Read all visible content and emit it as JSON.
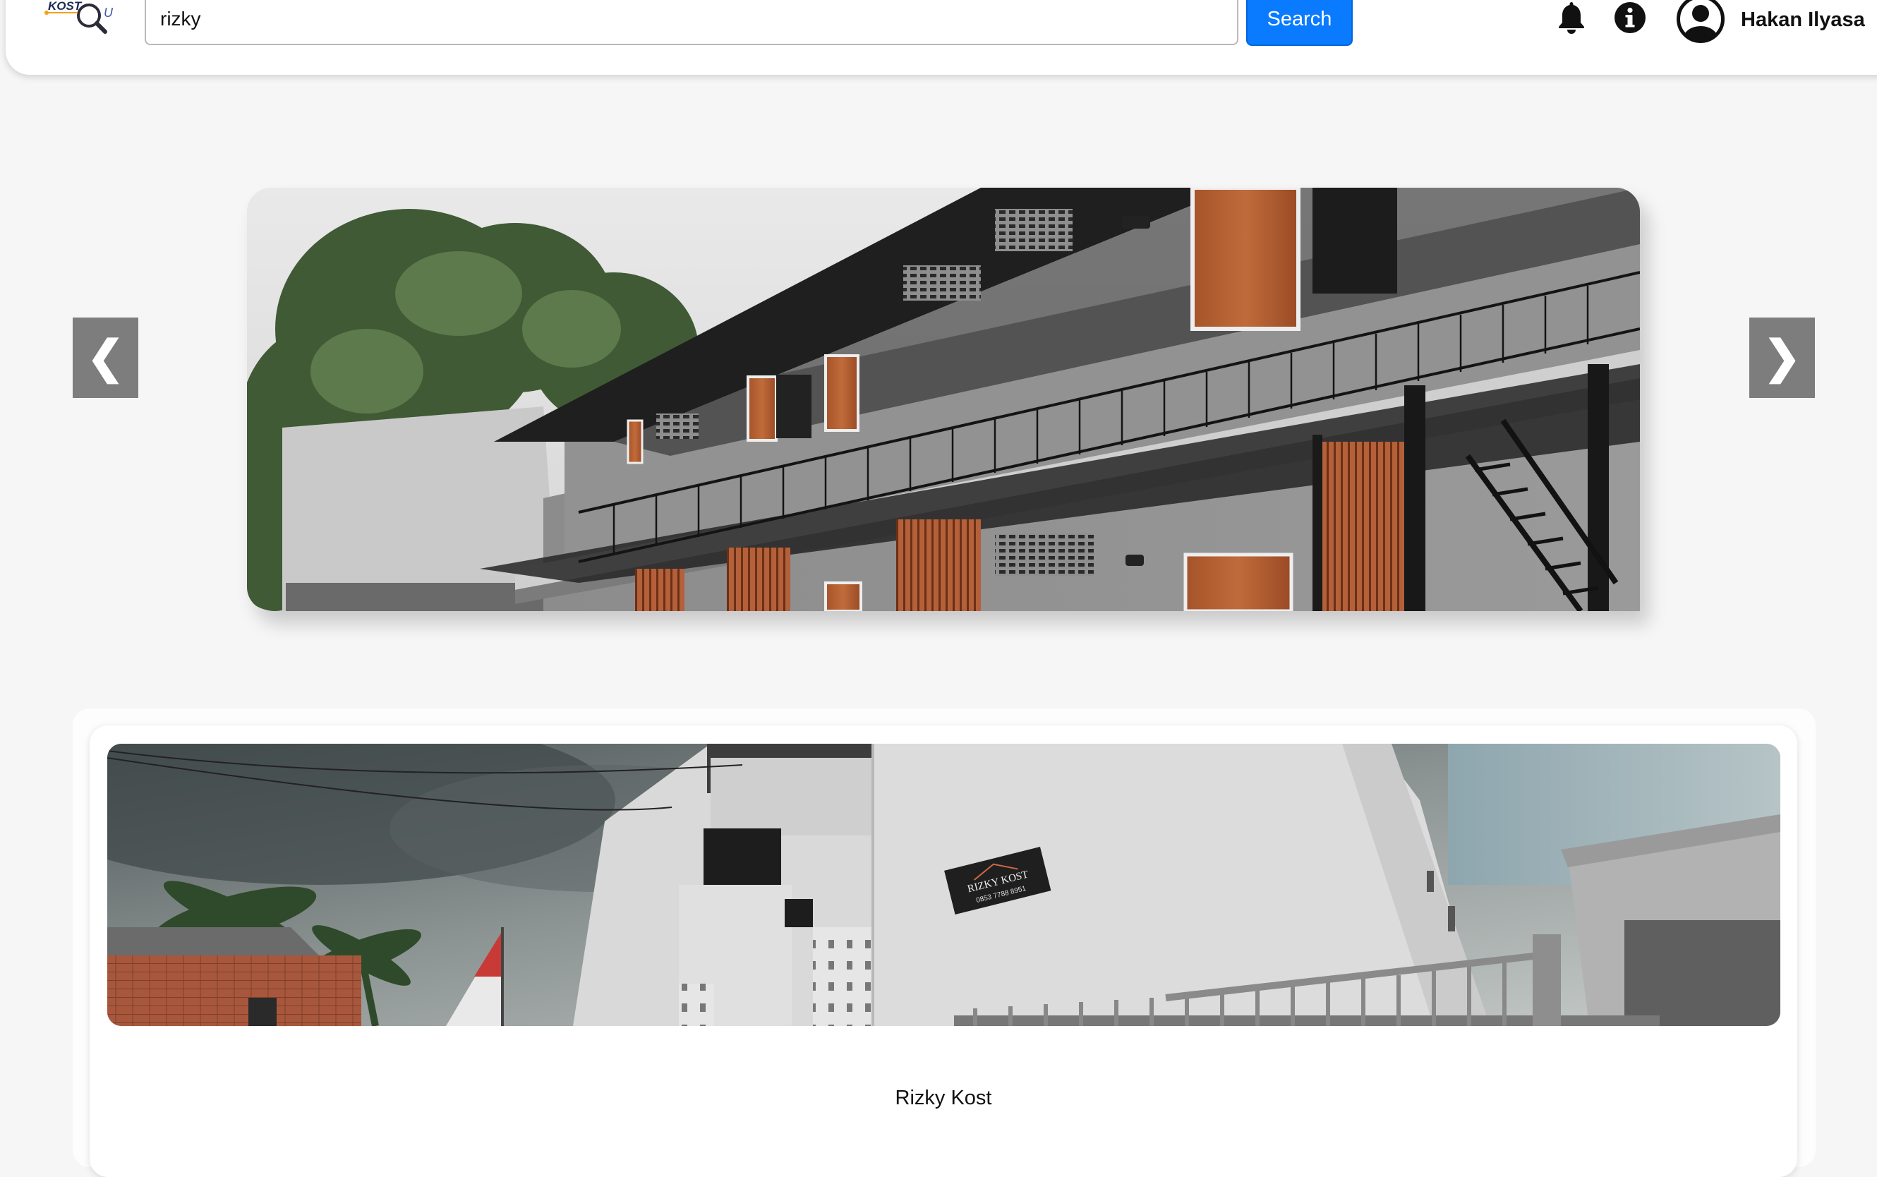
{
  "header": {
    "logo_text": "KOST",
    "logo_suffix": "U",
    "search": {
      "value": "rizky",
      "placeholder": ""
    },
    "search_button_label": "Search",
    "icons": [
      "bell-icon",
      "info-icon",
      "user-avatar-icon"
    ],
    "user_name": "Hakan Ilyasa"
  },
  "carousel": {
    "prev_label": "❮",
    "next_label": "❯",
    "slide_image": "two-storey-kost-building-photo"
  },
  "listings": [
    {
      "name": "Rizky Kost",
      "image": "rizky-kost-building-photo",
      "sign_text": "RIZKY KOST",
      "sign_phone": "0853 7788 8951"
    }
  ],
  "colors": {
    "page_background": "#f6f6f6",
    "search_button": "#0a7bff",
    "carousel_arrow": "#7d7d7d"
  }
}
